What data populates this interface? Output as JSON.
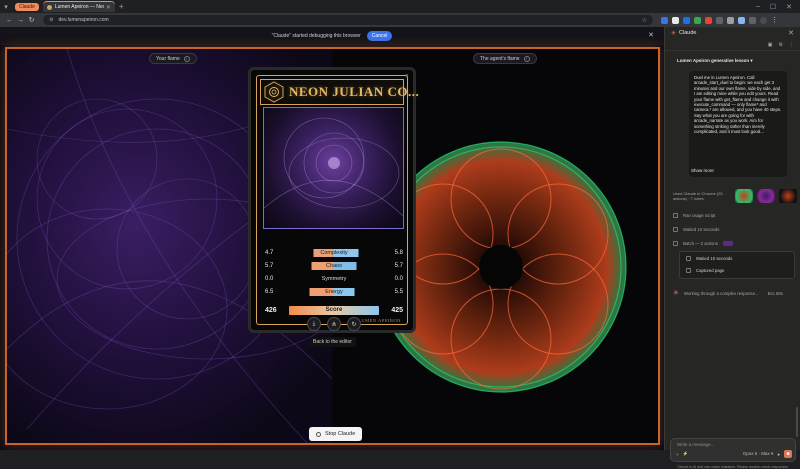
{
  "browser": {
    "group_chip": "Claude",
    "tab_title": "Lumen Apeiron — Neon Juli…",
    "url": "dev.lumenapeiron.com"
  },
  "debug_banner": {
    "text": "\"Claude\" started debugging this browser",
    "cancel_label": "Cancel"
  },
  "flame_labels": {
    "left": "Your flame",
    "right": "The agent's flame"
  },
  "card": {
    "title": "NEON JULIAN CO...",
    "footer": "LUMEN APEIRON",
    "stats": [
      {
        "name": "Complexity",
        "left": "4.7",
        "right": "5.8",
        "left_fraction": 0.45,
        "right_fraction": 0.55,
        "left_color": "#e8a07a",
        "right_color": "#8ec6ee"
      },
      {
        "name": "Chaos",
        "left": "5.7",
        "right": "5.7",
        "left_fraction": 0.5,
        "right_fraction": 0.5,
        "left_color": "#f0a070",
        "right_color": "#7fbde8"
      },
      {
        "name": "Symmetry",
        "left": "0.0",
        "right": "0.0",
        "left_fraction": 0,
        "right_fraction": 0,
        "left_color": "#e8a07a",
        "right_color": "#8ec6ee"
      },
      {
        "name": "Energy",
        "left": "6.5",
        "right": "5.5",
        "left_fraction": 0.54,
        "right_fraction": 0.46,
        "left_color": "#f0a070",
        "right_color": "#8ec6ee"
      }
    ],
    "score": {
      "name": "Score",
      "left": "426",
      "right": "425"
    }
  },
  "actions": {
    "back_to_editor": "Back to the editor",
    "stop_label": "Stop Claude"
  },
  "side_panel": {
    "header": "Claude",
    "session_title": "Lumen Apeiron generative lesson",
    "user_message": "Duel me in Lumen Apeiron. Call arcade_start_duel to begin: we each get 3 minutes and our own flame, side by side, and I am editing mine while you edit yours. Read your flame with get_flame and change it with execute_command — only flame* and camera.* are allowed, and you have 40 steps. Say what you are going for with arcade_narrate as you work. Aim for something striking rather than merely complicated, and it must look good...",
    "show_more": "Show more",
    "used_line": "Used Claude in Chrome (25 actions) · 7 notes",
    "steps": [
      {
        "label": "Ran usage script"
      },
      {
        "label": "Waited 10 seconds"
      },
      {
        "label": "Batch — 2 actions"
      }
    ],
    "batch_items": [
      "Waited 10 seconds",
      "Captured page"
    ],
    "working": "Working through a complex response...",
    "working_time": "Esc 59s",
    "composer_placeholder": "Write a message...",
    "model": "Opus 5",
    "mode": "Max",
    "disclaimer": "Claude is AI and can make mistakes. Please double-check responses."
  }
}
